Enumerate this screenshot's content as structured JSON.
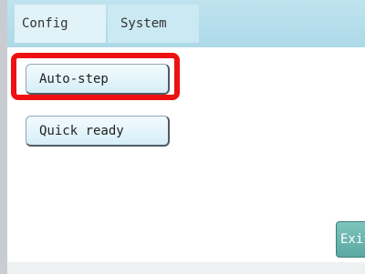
{
  "header": {
    "tabs": [
      {
        "label": "Config"
      },
      {
        "label": "System"
      }
    ]
  },
  "main": {
    "buttons": [
      {
        "label": "Auto-step"
      },
      {
        "label": "Quick ready"
      }
    ]
  },
  "footer": {
    "exit_label": "Exit"
  },
  "colors": {
    "header_bg": "#add9e8",
    "highlight": "#ee1111",
    "exit_bg": "#5aa9a2"
  }
}
